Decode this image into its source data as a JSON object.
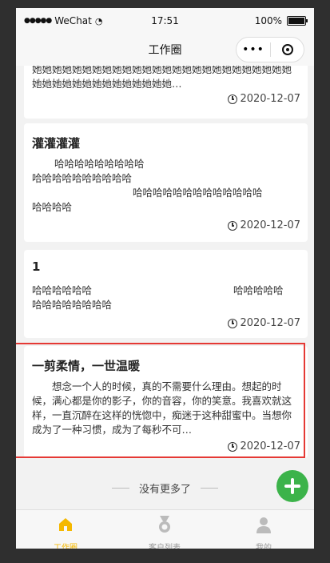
{
  "status": {
    "carrier": "WeChat",
    "time": "17:51",
    "battery": "100%",
    "battery_level": 1.0
  },
  "nav": {
    "title": "工作圈"
  },
  "posts": [
    {
      "title": "",
      "body": "她她她她她她她她她她她她她她她她她她她她她她她她她她她她她她她她她她她她她她她她…",
      "date": "2020-12-07"
    },
    {
      "title": "灌灌灌灌",
      "body1": "哈哈哈哈哈哈哈哈哈",
      "body2": "哈哈哈哈哈哈哈哈哈哈",
      "body3": "哈哈哈哈哈哈哈哈哈哈哈哈哈",
      "body4": "哈哈哈哈",
      "date": "2020-12-07"
    },
    {
      "title": "1",
      "body1": "哈哈哈哈哈哈",
      "body2": "哈哈哈哈哈",
      "body3": "哈哈哈哈哈哈哈哈",
      "date": "2020-12-07"
    },
    {
      "title": "一剪柔情，一世温暖",
      "body": "想念一个人的时候，真的不需要什么理由。想起的时候，满心都是你的影子，你的音容，你的笑意。我喜欢就这样，一直沉醉在这样的恍惚中，痴迷于这种甜蜜中。当想你成为了一种习惯，成为了每秒不可…",
      "date": "2020-12-07"
    }
  ],
  "footer": {
    "no_more": "没有更多了"
  },
  "tabs": [
    {
      "label": "工作圈",
      "icon": "home-icon",
      "active": true
    },
    {
      "label": "客户列表",
      "icon": "medal-icon",
      "active": false
    },
    {
      "label": "我的",
      "icon": "user-icon",
      "active": false
    }
  ],
  "colors": {
    "accent": "#f5b800",
    "fab": "#3cb34a",
    "highlight": "#e53935"
  }
}
